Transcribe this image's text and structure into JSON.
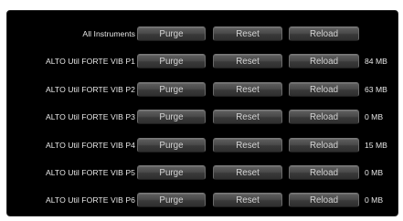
{
  "buttons": {
    "purge": "Purge",
    "reset": "Reset",
    "reload": "Reload"
  },
  "all_row": {
    "label": "All Instruments"
  },
  "instruments": [
    {
      "name": "ALTO Util FORTE VIB P1",
      "size": "84 MB"
    },
    {
      "name": "ALTO Util FORTE VIB P2",
      "size": "63 MB"
    },
    {
      "name": "ALTO Util FORTE VIB P3",
      "size": "0 MB"
    },
    {
      "name": "ALTO Util FORTE VIB P4",
      "size": "15 MB"
    },
    {
      "name": "ALTO Util FORTE VIB P5",
      "size": "0 MB"
    },
    {
      "name": "ALTO Util FORTE VIB P6",
      "size": "0 MB"
    }
  ],
  "colors": {
    "panel_background": "#000000",
    "text": "#e8e8e8",
    "button_text": "#d4d4d4"
  }
}
